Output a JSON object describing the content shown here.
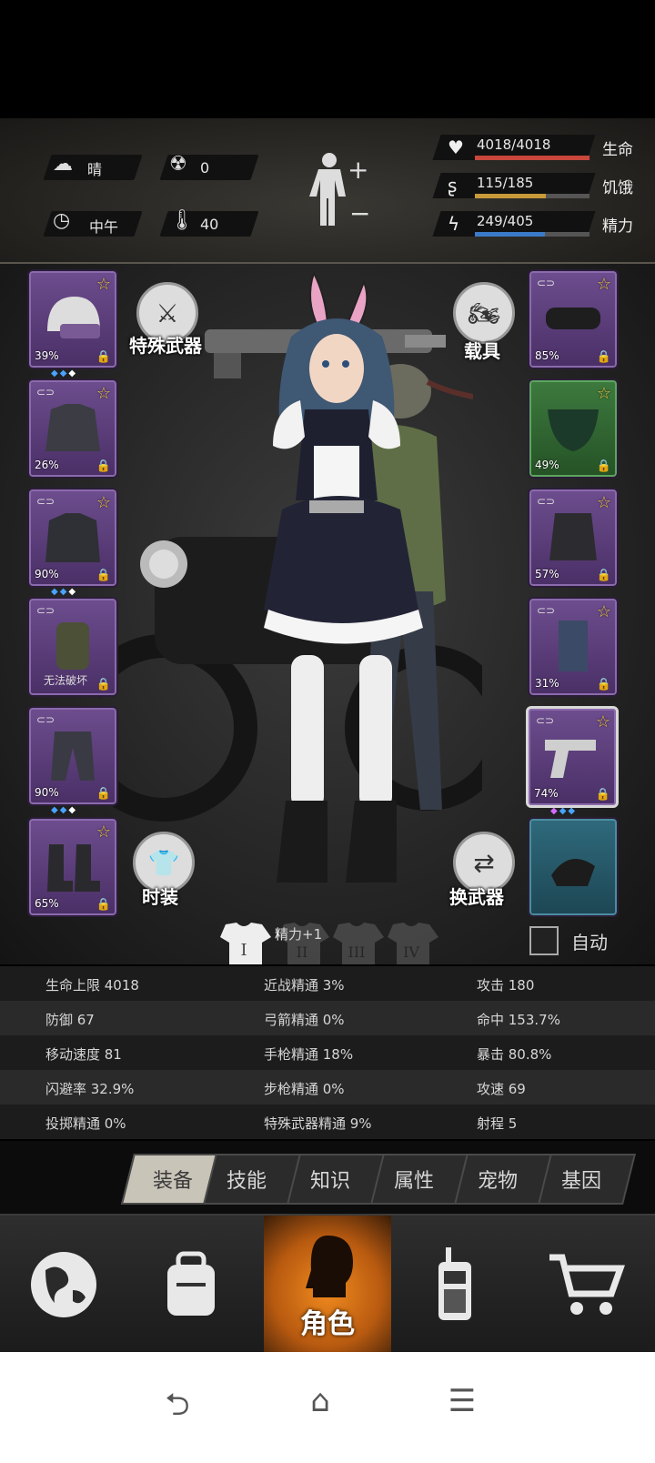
{
  "status": {
    "weather": "晴",
    "radiation": "0",
    "time_of_day": "中午",
    "temperature": "40"
  },
  "vitals": [
    {
      "icon": "heart-icon",
      "value": "4018/4018",
      "label": "生命",
      "color": "#c8463a",
      "fill": 1.0
    },
    {
      "icon": "stomach-icon",
      "value": "115/185",
      "label": "饥饿",
      "color": "#c89a3a",
      "fill": 0.62
    },
    {
      "icon": "lightning-icon",
      "value": "249/405",
      "label": "精力",
      "color": "#3a7ac8",
      "fill": 0.61
    }
  ],
  "left_slots": [
    {
      "name": "helmet-slot",
      "pct": "39%",
      "quality": "purple"
    },
    {
      "name": "shirt-slot",
      "pct": "26%",
      "quality": "purple"
    },
    {
      "name": "jacket-slot",
      "pct": "90%",
      "quality": "purple"
    },
    {
      "name": "backpack-slot",
      "text": "无法破坏",
      "quality": "purple"
    },
    {
      "name": "pants-slot",
      "pct": "90%",
      "quality": "purple"
    },
    {
      "name": "boots-slot",
      "pct": "65%",
      "quality": "purple"
    }
  ],
  "right_slots": [
    {
      "name": "goggles-slot",
      "pct": "85%",
      "quality": "purple"
    },
    {
      "name": "mask-slot",
      "pct": "49%",
      "quality": "green"
    },
    {
      "name": "vest-slot",
      "pct": "57%",
      "quality": "purple"
    },
    {
      "name": "shield-slot",
      "pct": "31%",
      "quality": "purple"
    },
    {
      "name": "pistol-slot",
      "pct": "74%",
      "quality": "purple"
    },
    {
      "name": "bag-slot",
      "pct": "",
      "quality": "blue"
    }
  ],
  "scene_buttons": {
    "special_weapon": "特殊武器",
    "vehicle": "载具",
    "fashion": "时装",
    "swap_weapon": "换武器"
  },
  "outfit": {
    "bonus": "精力+1",
    "sets": [
      "I",
      "II",
      "III",
      "IV"
    ],
    "auto_label": "自动"
  },
  "stats": [
    [
      "生命上限 4018",
      "近战精通 3%",
      "攻击 180"
    ],
    [
      "防御 67",
      "弓箭精通 0%",
      "命中 153.7%"
    ],
    [
      "移动速度 81",
      "手枪精通 18%",
      "暴击 80.8%"
    ],
    [
      "闪避率 32.9%",
      "步枪精通 0%",
      "攻速 69"
    ],
    [
      "投掷精通 0%",
      "特殊武器精通 9%",
      "射程 5"
    ]
  ],
  "tabs": [
    "装备",
    "技能",
    "知识",
    "属性",
    "宠物",
    "基因"
  ],
  "active_tab": "装备",
  "nav": {
    "character_label": "角色"
  }
}
